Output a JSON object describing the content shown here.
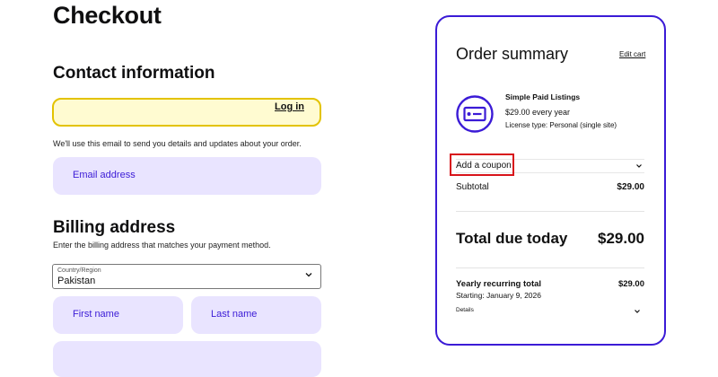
{
  "page": {
    "title": "Checkout"
  },
  "contact": {
    "title": "Contact information",
    "login_label": "Log in",
    "helper": "We'll use this email to send you details and updates about your order.",
    "email_placeholder": "Email address"
  },
  "billing": {
    "title": "Billing address",
    "helper": "Enter the billing address that matches your payment method.",
    "country_label": "Country/Region",
    "country_value": "Pakistan",
    "first_name_placeholder": "First name",
    "last_name_placeholder": "Last name"
  },
  "summary": {
    "title": "Order summary",
    "edit_cart": "Edit cart",
    "product": {
      "name": "Simple Paid Listings",
      "price": "$29.00 every year",
      "license": "License type: Personal (single site)",
      "icon": "license-card-icon"
    },
    "coupon_label": "Add a coupon",
    "subtotal_label": "Subtotal",
    "subtotal_value": "$29.00",
    "due_label": "Total due today",
    "due_value": "$29.00",
    "recurring_label": "Yearly recurring total",
    "recurring_value": "$29.00",
    "starting": "Starting: January 9, 2026",
    "details_label": "Details"
  },
  "colors": {
    "accent": "#3b1bd6",
    "field_bg": "#e9e4ff",
    "login_border": "#e3c300",
    "login_bg": "#fffbd1",
    "highlight": "#d8141b"
  }
}
